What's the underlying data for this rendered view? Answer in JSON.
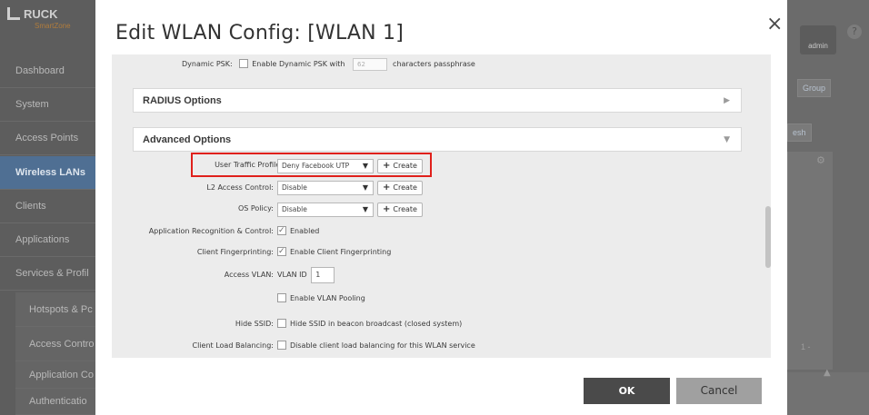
{
  "background": {
    "logo_text": "RUCK",
    "logo_sub": "SmartZone",
    "nav": [
      {
        "label": "Dashboard",
        "active": false
      },
      {
        "label": "System",
        "active": false
      },
      {
        "label": "Access Points",
        "active": false
      },
      {
        "label": "Wireless LANs",
        "active": true
      },
      {
        "label": "Clients",
        "active": false
      },
      {
        "label": "Applications",
        "active": false
      },
      {
        "label": "Services & Profil",
        "active": false
      }
    ],
    "subnav": [
      "Hotspots & Pc",
      "Access Contro",
      "Application Co",
      "Authenticatio"
    ],
    "user_label": "admin",
    "help_icon": "?",
    "group_chip": "Group",
    "refresh_chip": "esh",
    "pager_text": "1 -"
  },
  "modal": {
    "title": "Edit WLAN Config: [WLAN 1]",
    "close": "×",
    "dynamic_psk": {
      "label": "Dynamic PSK:",
      "checkbox_text": "Enable Dynamic PSK with",
      "length_value": "62",
      "suffix": "characters passphrase"
    },
    "sections": {
      "radius": {
        "title": "RADIUS Options",
        "arrow": "▶"
      },
      "advanced": {
        "title": "Advanced Options",
        "arrow": "▼"
      }
    },
    "user_traffic_profile": {
      "label": "User Traffic Profile:",
      "value": "Deny Facebook UTP",
      "create": "Create"
    },
    "l2_access_control": {
      "label": "L2 Access Control:",
      "value": "Disable",
      "create": "Create"
    },
    "os_policy": {
      "label": "OS Policy:",
      "value": "Disable",
      "create": "Create"
    },
    "app_recognition": {
      "label": "Application Recognition & Control:",
      "text": "Enabled",
      "checked": true
    },
    "client_fingerprinting": {
      "label": "Client Fingerprinting:",
      "text": "Enable Client Fingerprinting",
      "checked": true
    },
    "access_vlan": {
      "label": "Access VLAN:",
      "prefix": "VLAN ID",
      "value": "1"
    },
    "vlan_pooling": {
      "text": "Enable VLAN Pooling",
      "checked": false
    },
    "hide_ssid": {
      "label": "Hide SSID:",
      "text": "Hide SSID in beacon broadcast (closed system)",
      "checked": false
    },
    "load_balancing": {
      "label": "Client Load Balancing:",
      "text": "Disable client load balancing for this WLAN service",
      "checked": false
    },
    "ok_label": "OK",
    "cancel_label": "Cancel"
  },
  "colors": {
    "highlight": "#e0201b",
    "ok_bg": "#4a4a4a",
    "cancel_bg": "#a0a0a0",
    "nav_active": "#4f6f93"
  }
}
